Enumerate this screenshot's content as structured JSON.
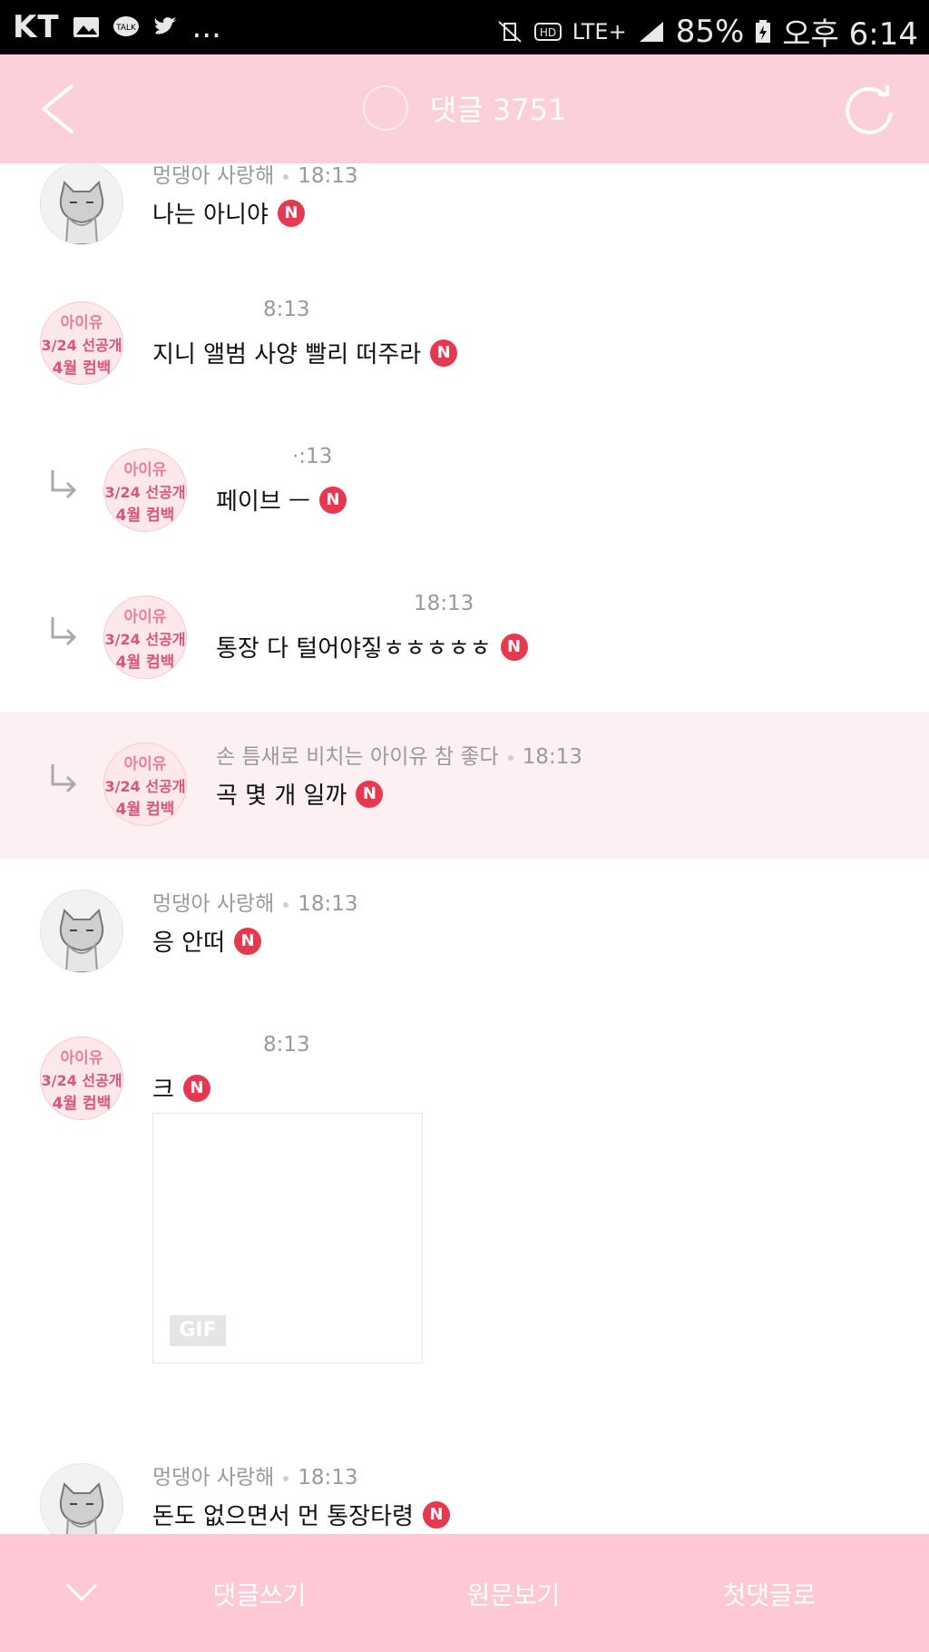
{
  "status_bar": {
    "carrier": "KT",
    "more": "...",
    "network": "LTE+",
    "battery": "85%",
    "time": "오후 6:14"
  },
  "header": {
    "title": "댓글 3751",
    "back_icon": "chevron-left-icon",
    "refresh_icon": "refresh-icon",
    "bell_icon": "bell-icon"
  },
  "avatars": {
    "iu": {
      "line1": "아이유",
      "line2": "3/24 선공개",
      "line3": "4월 컴백"
    }
  },
  "comments": [
    {
      "author": "멍댕아 사랑해",
      "time": "18:13",
      "text": "나는 아니야",
      "new": "N"
    },
    {
      "author": "",
      "time": "8:13",
      "text": "지니 앨범 사양 빨리 떠주라",
      "new": "N"
    },
    {
      "author": "",
      "time": "·:13",
      "text": "페이브 ㅡ",
      "new": "N"
    },
    {
      "author": "",
      "time": "18:13",
      "text": "통장 다 털어야짛ㅎㅎㅎㅎㅎ",
      "new": "N"
    },
    {
      "author": "손 틈새로 비치는 아이유 참 좋다",
      "time": "18:13",
      "text": "곡 몇 개 일까",
      "new": "N"
    },
    {
      "author": "멍댕아 사랑해",
      "time": "18:13",
      "text": "응 안떠",
      "new": "N"
    },
    {
      "author": "",
      "time": "8:13",
      "text": "크",
      "new": "N",
      "attachment": "GIF"
    },
    {
      "author": "멍댕아 사랑해",
      "time": "18:13",
      "text": "돈도 없으면서 먼 통장타령",
      "new": "N"
    }
  ],
  "bottom_bar": {
    "collapse_icon": "chevron-down-icon",
    "write": "댓글쓰기",
    "original": "원문보기",
    "first": "첫댓글로"
  }
}
